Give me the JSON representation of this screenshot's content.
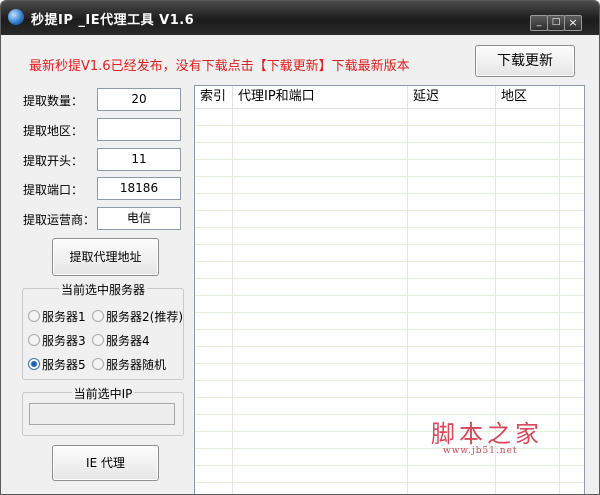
{
  "window": {
    "title": "秒提IP _IE代理工具 V1.6",
    "controls": {
      "minimize": "_",
      "maximize": "□",
      "close": "×"
    }
  },
  "notice": {
    "text": "最新秒提V1.6已经发布，没有下载点击【下载更新】下载最新版本",
    "color": "#e11e1e"
  },
  "download_button": "下载更新",
  "form": {
    "fields": [
      {
        "label": "提取数量：",
        "value": "20"
      },
      {
        "label": "提取地区：",
        "value": ""
      },
      {
        "label": "提取开头：",
        "value": "11"
      },
      {
        "label": "提取端口：",
        "value": "18186"
      },
      {
        "label": "提取运营商：",
        "value": "电信"
      }
    ]
  },
  "extract_button": "提取代理地址",
  "server_group": {
    "title": "当前选中服务器",
    "options": [
      {
        "label": "服务器1",
        "selected": false
      },
      {
        "label": "服务器2(推荐)",
        "selected": false
      },
      {
        "label": "服务器3",
        "selected": false
      },
      {
        "label": "服务器4",
        "selected": false
      },
      {
        "label": "服务器5",
        "selected": true
      },
      {
        "label": "服务器随机",
        "selected": false
      }
    ]
  },
  "ip_group": {
    "title": "当前选中IP",
    "value": ""
  },
  "ie_button": "IE 代理",
  "table": {
    "columns": [
      "索引",
      "代理IP和端口",
      "延迟",
      "地区"
    ],
    "rows": []
  },
  "watermark": {
    "main": "脚本之家",
    "sub": "www.jb51.net"
  }
}
